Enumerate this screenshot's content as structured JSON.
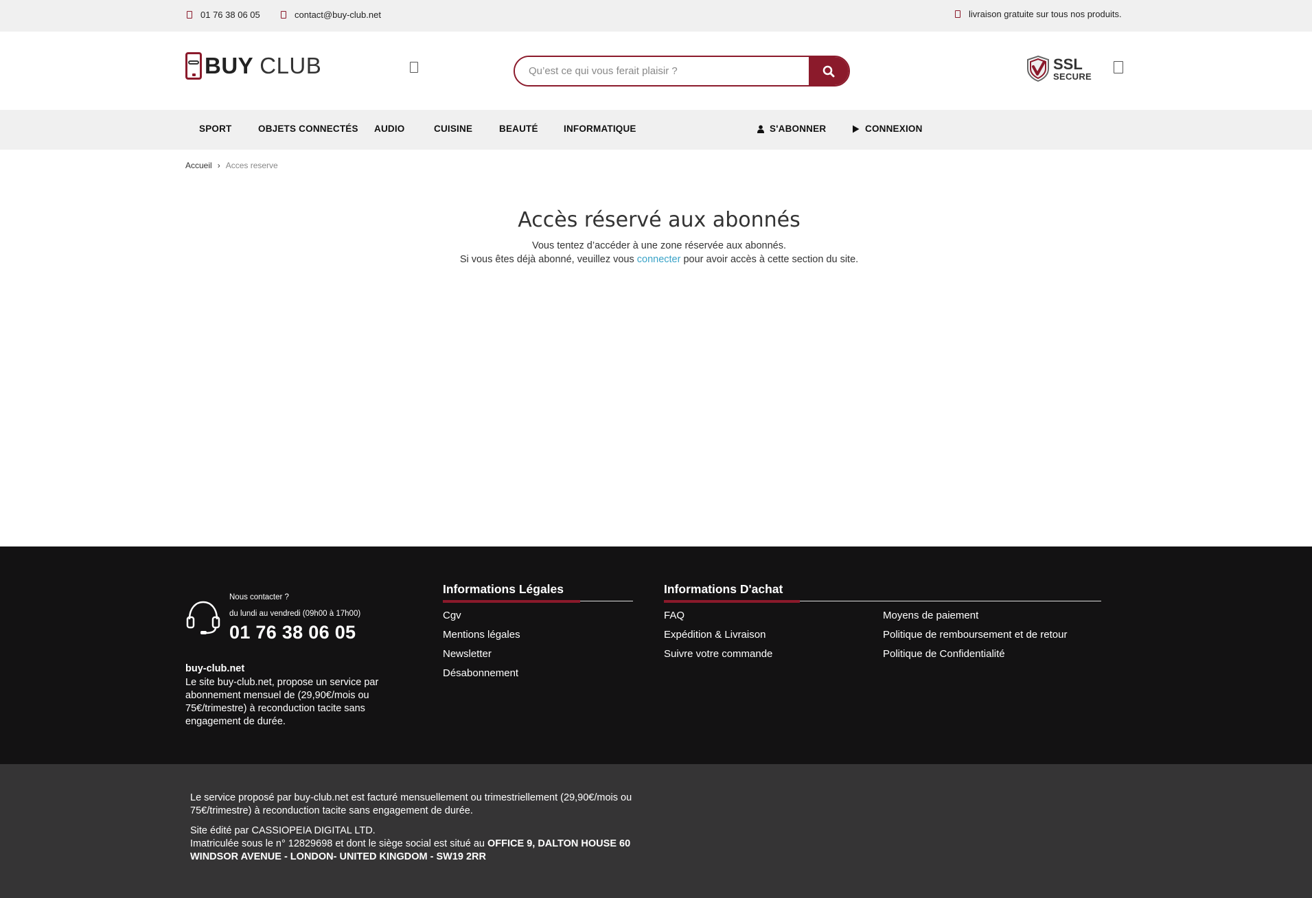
{
  "topbar": {
    "phone": "01 76 38 06 05",
    "email": "contact@buy-club.net",
    "shipping": "livraison gratuite sur tous nos produits."
  },
  "header": {
    "logo_buy": "BUY",
    "logo_club": "CLUB",
    "search_placeholder": "Qu’est ce qui vous ferait plaisir ?",
    "ssl_big": "SSL",
    "ssl_small": "SECURE"
  },
  "nav": {
    "items": [
      "SPORT",
      "OBJETS CONNECTÉS",
      "AUDIO",
      "CUISINE",
      "BEAUTÉ",
      "INFORMATIQUE"
    ],
    "subscribe": "S'ABONNER",
    "login": "CONNEXION"
  },
  "breadcrumb": {
    "home": "Accueil",
    "separator": "›",
    "current": "Acces reserve"
  },
  "main": {
    "title": "Accès réservé aux abonnés",
    "line1": "Vous tentez d’accéder à une zone réservée aux abonnés.",
    "line2_before": "Si vous êtes déjà abonné, veuillez vous ",
    "line2_link": "connecter",
    "line2_after": " pour avoir accès à cette section du site."
  },
  "footer": {
    "contact_question": "Nous contacter ?",
    "contact_hours": "du lundi au vendredi (09h00 à 17h00)",
    "contact_phone": "01 76 38 06 05",
    "site_name": "buy-club.net",
    "site_desc": "Le site buy-club.net, propose un service par abonnement mensuel de (29,90€/mois ou 75€/trimestre) à reconduction tacite sans engagement de durée.",
    "legal_title": "Informations Légales",
    "legal_links": [
      "Cgv",
      "Mentions légales",
      "Newsletter",
      "Désabonnement"
    ],
    "purchase_title": "Informations D'achat",
    "purchase_links_col1": [
      "FAQ",
      "Expédition & Livraison",
      "Suivre votre commande"
    ],
    "purchase_links_col2": [
      "Moyens de paiement",
      "Politique de remboursement et de retour",
      "Politique de Confidentialité"
    ]
  },
  "subfooter": {
    "billing": "Le service proposé par buy-club.net est facturé mensuellement ou trimestriellement (29,90€/mois ou 75€/trimestre) à reconduction tacite sans engagement de durée.",
    "editor": "Site édité par CASSIOPEIA DIGITAL LTD.",
    "registration": "Imatriculée sous le n° 12829698 et dont le siège social est situé au ",
    "address": "OFFICE 9, DALTON HOUSE 60 WINDSOR AVENUE - LONDON- UNITED KINGDOM - SW19 2RR"
  },
  "colors": {
    "brand": "#8b1a2b",
    "link": "#3aa3c7",
    "footer_bg": "#131213",
    "subfooter_bg": "#353435",
    "bar_bg": "#f0f0f0"
  }
}
